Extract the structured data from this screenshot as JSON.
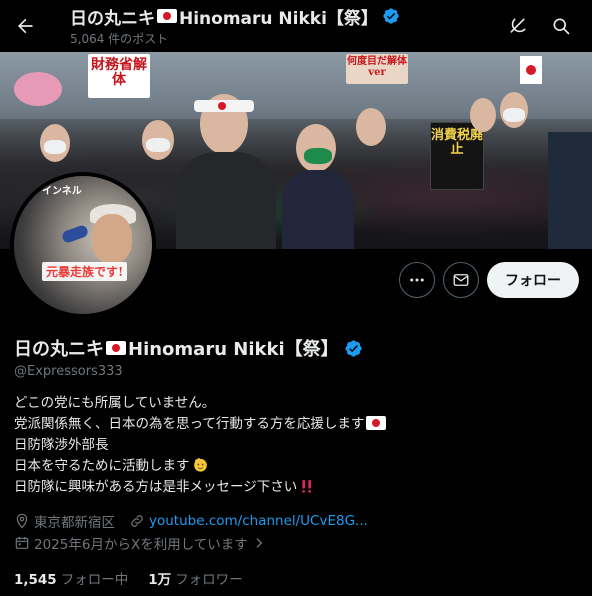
{
  "topbar": {
    "name": "日の丸ニキ",
    "name_suffix": "Hinomaru Nikki【祭】",
    "posts": "5,064 件のポスト"
  },
  "banner": {
    "signs": [
      "財務省解体",
      "消費税廃止",
      "何度目だ解体ver"
    ],
    "headband": "日の丸"
  },
  "avatar": {
    "top_text": "インネル",
    "caption": "元暴走族です!"
  },
  "actions": {
    "follow_label": "フォロー"
  },
  "profile": {
    "name": "日の丸ニキ",
    "name_suffix": "Hinomaru Nikki【祭】",
    "handle": "@Expressors333",
    "bio": [
      "どこの党にも所属していません。",
      "党派関係無く、日本の為を思って行動する方を応援します",
      "日防隊渉外部長",
      "日本を守るために活動します",
      "日防隊に興味がある方は是非メッセージ下さい"
    ],
    "location": "東京都新宿区",
    "website": "youtube.com/channel/UCvE8G...",
    "joined": "2025年6月からXを利用しています"
  },
  "stats": {
    "following_count": "1,545",
    "following_label": "フォロー中",
    "followers_count": "1万",
    "followers_label": "フォロワー"
  },
  "colors": {
    "accent": "#1d9bf0",
    "verified": "#1d9bf0",
    "muted": "#71767b",
    "text": "#e7e9ea"
  },
  "icons": [
    "back-arrow-icon",
    "verified-badge-icon",
    "grok-icon",
    "search-icon",
    "more-icon",
    "mail-icon",
    "location-icon",
    "link-icon",
    "calendar-icon",
    "chevron-right-icon",
    "japan-flag-icon",
    "emoji-salute-icon",
    "double-exclamation-icon"
  ]
}
